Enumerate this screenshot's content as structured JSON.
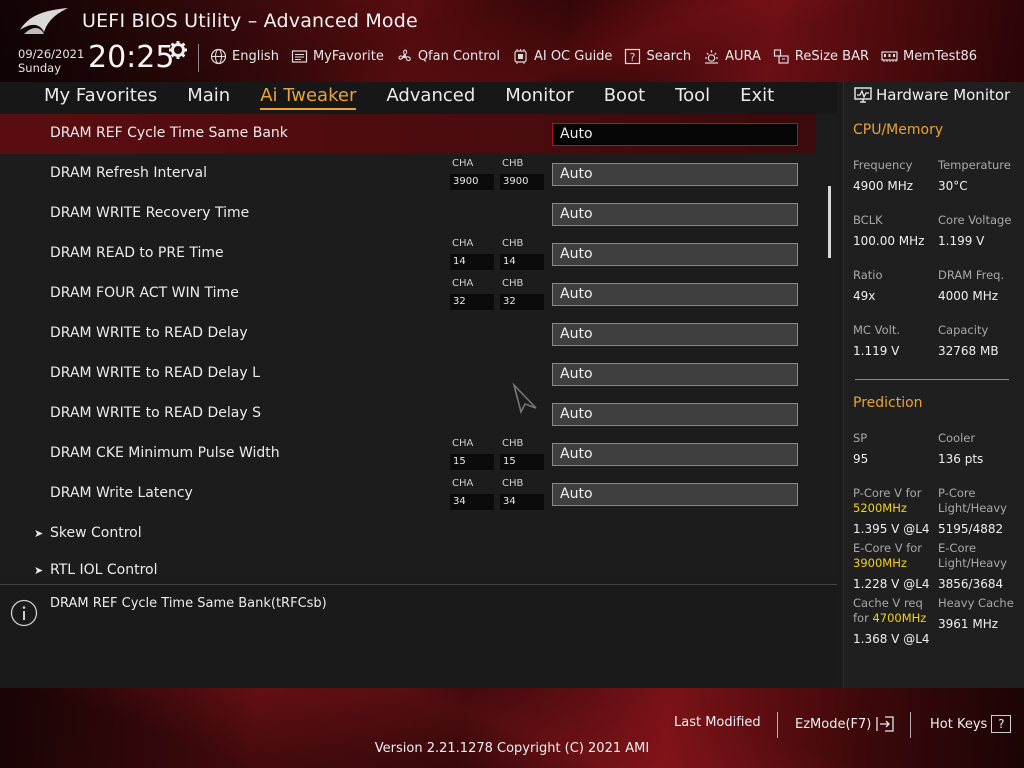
{
  "header": {
    "title": "UEFI BIOS Utility – Advanced Mode",
    "date": "09/26/2021",
    "day": "Sunday",
    "time": "20:25",
    "toolbar": [
      {
        "label": "English",
        "icon": "globe-icon"
      },
      {
        "label": "MyFavorite",
        "icon": "favorite-list-icon"
      },
      {
        "label": "Qfan Control",
        "icon": "fan-icon"
      },
      {
        "label": "AI OC Guide",
        "icon": "oc-guide-icon"
      },
      {
        "label": "Search",
        "icon": "search-help-icon"
      },
      {
        "label": "AURA",
        "icon": "aura-icon"
      },
      {
        "label": "ReSize BAR",
        "icon": "resize-bar-icon"
      },
      {
        "label": "MemTest86",
        "icon": "memory-icon"
      }
    ]
  },
  "nav": {
    "tabs": [
      "My Favorites",
      "Main",
      "Ai Tweaker",
      "Advanced",
      "Monitor",
      "Boot",
      "Tool",
      "Exit"
    ],
    "active": "Ai Tweaker"
  },
  "settings": [
    {
      "label": "DRAM REF Cycle Time Same Bank",
      "value": "Auto",
      "selected": true
    },
    {
      "label": "DRAM Refresh Interval",
      "value": "Auto",
      "cha": "3900",
      "chb": "3900"
    },
    {
      "label": "DRAM WRITE Recovery Time",
      "value": "Auto"
    },
    {
      "label": "DRAM READ to PRE Time",
      "value": "Auto",
      "cha": "14",
      "chb": "14"
    },
    {
      "label": "DRAM FOUR ACT WIN Time",
      "value": "Auto",
      "cha": "32",
      "chb": "32"
    },
    {
      "label": "DRAM WRITE to READ Delay",
      "value": "Auto"
    },
    {
      "label": "DRAM WRITE to READ Delay L",
      "value": "Auto"
    },
    {
      "label": "DRAM WRITE to READ Delay S",
      "value": "Auto"
    },
    {
      "label": "DRAM CKE Minimum Pulse Width",
      "value": "Auto",
      "cha": "15",
      "chb": "15"
    },
    {
      "label": "DRAM Write Latency",
      "value": "Auto",
      "cha": "34",
      "chb": "34"
    }
  ],
  "channel_labels": {
    "a": "CHA",
    "b": "CHB"
  },
  "groups": [
    "Skew Control",
    "RTL IOL Control"
  ],
  "help": {
    "text": "DRAM REF Cycle Time Same Bank(tRFCsb)"
  },
  "sidebar": {
    "title": "Hardware Monitor",
    "cpu_section": "CPU/Memory",
    "cpu": [
      {
        "k": "Frequency",
        "v": "4900 MHz"
      },
      {
        "k": "Temperature",
        "v": "30°C"
      },
      {
        "k": "BCLK",
        "v": "100.00 MHz"
      },
      {
        "k": "Core Voltage",
        "v": "1.199 V"
      },
      {
        "k": "Ratio",
        "v": "49x"
      },
      {
        "k": "DRAM Freq.",
        "v": "4000 MHz"
      },
      {
        "k": "MC Volt.",
        "v": "1.119 V"
      },
      {
        "k": "Capacity",
        "v": "32768 MB"
      }
    ],
    "prediction_section": "Prediction",
    "sp_label": "SP",
    "sp_value": "95",
    "cooler_label": "Cooler",
    "cooler_value": "136 pts",
    "pcore_label": "P-Core V for",
    "pcore_freq": "5200MHz",
    "pcore_value": "1.395 V @L4",
    "pcore_lh_label": "P-Core Light/Heavy",
    "pcore_lh_value": "5195/4882",
    "ecore_label": "E-Core V for",
    "ecore_freq": "3900MHz",
    "ecore_value": "1.228 V @L4",
    "ecore_lh_label": "E-Core Light/Heavy",
    "ecore_lh_value": "3856/3684",
    "cache_label_1": "Cache V req",
    "cache_label_2": "for",
    "cache_freq": "4700MHz",
    "cache_value": "1.368 V @L4",
    "heavy_cache_label": "Heavy Cache",
    "heavy_cache_value": "3961 MHz"
  },
  "footer": {
    "last_modified": "Last Modified",
    "ezmode": "EzMode(F7)",
    "hot_keys": "Hot Keys",
    "hot_keys_box": "?",
    "version": "Version 2.21.1278 Copyright (C) 2021 AMI"
  },
  "colors": {
    "accent": "#e8a33b",
    "highlight": "#f2d21c",
    "selected_row": "#5a0d11"
  }
}
